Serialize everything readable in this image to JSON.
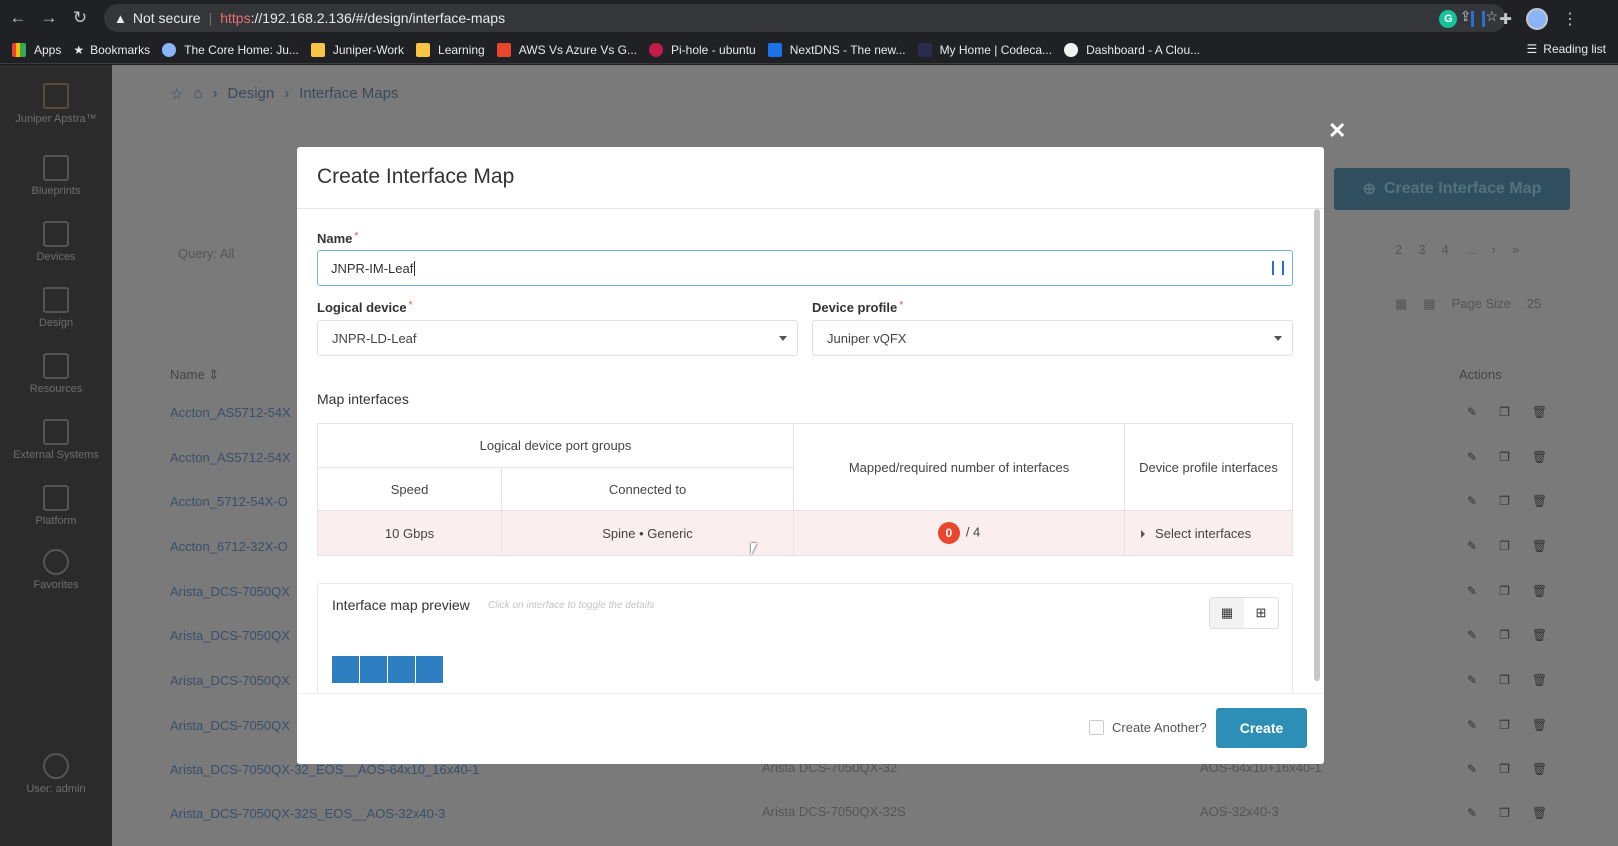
{
  "browser": {
    "security_label": "Not secure",
    "url_scheme": "https",
    "url_rest": "://192.168.2.136/#/design/interface-maps",
    "ext_g": "G",
    "reading_list": "Reading list",
    "bookmarks": [
      "Apps",
      "Bookmarks",
      "The Core Home: Ju...",
      "Juniper-Work",
      "Learning",
      "AWS Vs Azure Vs G...",
      "Pi-hole - ubuntu",
      "NextDNS - The new...",
      "My Home | Codeca...",
      "Dashboard - A Clou..."
    ]
  },
  "sidebar": {
    "brand": "Juniper Apstra™",
    "items": [
      "Blueprints",
      "Devices",
      "Design",
      "Resources",
      "External Systems",
      "Platform",
      "Favorites"
    ],
    "user": "User: admin"
  },
  "background": {
    "crumb_design": "Design",
    "crumb_page": "Interface Maps",
    "create_button": "Create Interface Map",
    "query": "Query: All",
    "name_col": "Name",
    "actions_col": "Actions",
    "page_size_label": "Page Size",
    "page_size_value": "25",
    "pages": [
      "2",
      "3",
      "4",
      "..."
    ],
    "rows": [
      "Accton_AS5712-54X",
      "Accton_AS5712-54X",
      "Accton_5712-54X-O",
      "Accton_6712-32X-O",
      "Arista_DCS-7050QX",
      "Arista_DCS-7050QX",
      "Arista_DCS-7050QX",
      "Arista_DCS-7050QX",
      "Arista_DCS-7050QX-32_EOS__AOS-64x10_16x40-1",
      "Arista_DCS-7050QX-32S_EOS__AOS-32x40-3"
    ],
    "row_mid": [
      "Arista DCS-7050QX-32",
      "Arista DCS-7050QX-32S"
    ],
    "row_right": [
      "AOS-64x10+16x40-1",
      "AOS-32x40-3"
    ]
  },
  "modal": {
    "title": "Create Interface Map",
    "name_label": "Name",
    "name_value": "JNPR-IM-Leaf",
    "logical_device_label": "Logical device",
    "logical_device_value": "JNPR-LD-Leaf",
    "device_profile_label": "Device profile",
    "device_profile_value": "Juniper vQFX",
    "map_interfaces_title": "Map interfaces",
    "table": {
      "group_header": "Logical device port groups",
      "speed_header": "Speed",
      "connected_header": "Connected to",
      "mapped_header": "Mapped/required number of interfaces",
      "profile_header": "Device profile interfaces",
      "row": {
        "speed": "10 Gbps",
        "connected": "Spine • Generic",
        "mapped": "0",
        "required": "/ 4",
        "select": "Select interfaces"
      }
    },
    "preview_title": "Interface map preview",
    "preview_hint": "Click on interface to toggle the details",
    "create_another": "Create Another?",
    "create_button": "Create"
  }
}
